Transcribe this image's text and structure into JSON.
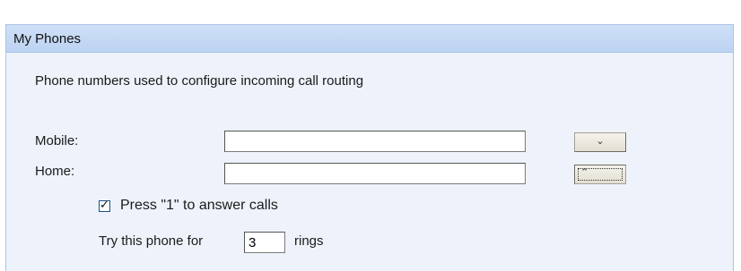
{
  "panel": {
    "title": "My Phones",
    "description": "Phone numbers used to configure incoming call routing"
  },
  "fields": {
    "mobile": {
      "label": "Mobile:",
      "value": ""
    },
    "home": {
      "label": "Home:",
      "value": ""
    }
  },
  "buttons": {
    "mobile_dropdown_icon": "chevron-down-icon",
    "mobile_dropdown_glyph": "⌄",
    "home_dropdown_icon": "chevron-up-icon",
    "home_dropdown_glyph": "⌃"
  },
  "options": {
    "press_one": {
      "label": "Press \"1\" to answer calls",
      "checked": true,
      "check_glyph": "✓"
    },
    "rings": {
      "prefix": "Try this phone for",
      "value": "3",
      "suffix": "rings"
    }
  },
  "colors": {
    "header_bg": "#c6dbf5",
    "panel_bg": "#eef3fb",
    "border": "#a9c4e8"
  }
}
